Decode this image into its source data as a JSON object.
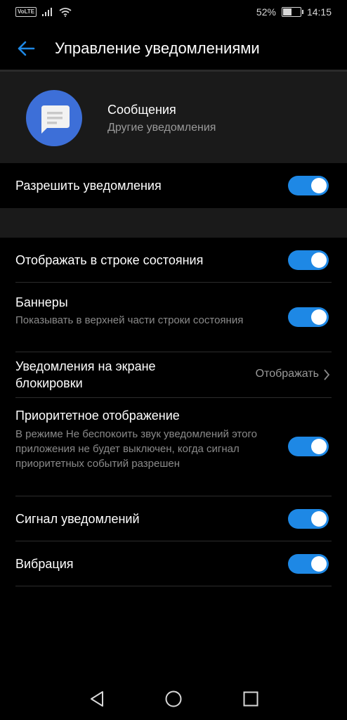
{
  "status_bar": {
    "volte": "VoLTE",
    "battery": "52%",
    "battery_level": 0.52,
    "time": "14:15"
  },
  "app_bar": {
    "title": "Управление уведомлениями",
    "back_icon": "arrow-left-icon"
  },
  "app": {
    "name": "Сообщения",
    "subtitle": "Другие уведомления",
    "icon": "message-bubble-icon",
    "icon_color": "#3d6fd8"
  },
  "allow": {
    "label": "Разрешить уведомления",
    "enabled": true
  },
  "settings": {
    "status_bar_row": {
      "label": "Отображать в строке состояния",
      "enabled": true
    },
    "banners": {
      "label": "Баннеры",
      "subtitle": "Показывать в верхней части строки состояния",
      "enabled": true
    },
    "lock_screen": {
      "label": "Уведомления на экране блокировки",
      "value": "Отображать"
    },
    "priority": {
      "label": "Приоритетное отображение",
      "subtitle": "В режиме Не беспокоить звук уведомлений этого приложения не будет выключен, когда сигнал приоритетных событий разрешен",
      "enabled": true
    },
    "sound": {
      "label": "Сигнал уведомлений",
      "enabled": true
    },
    "vibration": {
      "label": "Вибрация",
      "enabled": true
    }
  },
  "colors": {
    "accent": "#1e88e5",
    "background": "#000000",
    "card": "#1a1a1a"
  },
  "nav": {
    "back_icon": "triangle-back-icon",
    "home_icon": "circle-home-icon",
    "recents_icon": "square-recents-icon"
  }
}
